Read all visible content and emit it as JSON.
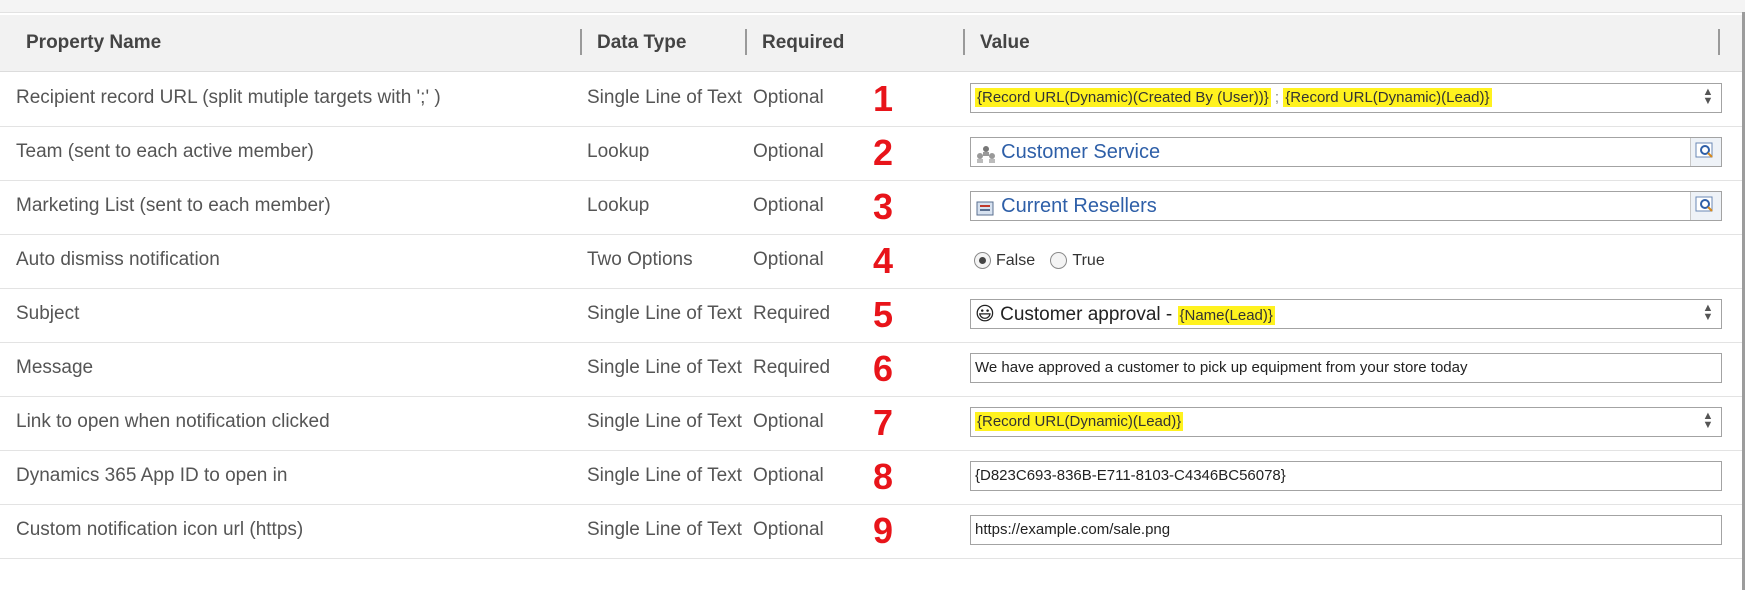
{
  "header": {
    "property_name": "Property Name",
    "data_type": "Data Type",
    "required": "Required",
    "value": "Value"
  },
  "rows": [
    {
      "name": "Recipient record URL (split mutiple targets with ';' )",
      "type": "Single Line of Text",
      "required": "Optional",
      "number": "1",
      "value_a": "{Record URL(Dynamic)(Created By (User))}",
      "separator": ";",
      "value_b": "{Record URL(Dynamic)(Lead)}"
    },
    {
      "name": "Team (sent to each active member)",
      "type": "Lookup",
      "required": "Optional",
      "number": "2",
      "value": "Customer Service",
      "icon": "team-icon"
    },
    {
      "name": "Marketing List (sent to each member)",
      "type": "Lookup",
      "required": "Optional",
      "number": "3",
      "value": "Current Resellers",
      "icon": "marketing-list-icon"
    },
    {
      "name": "Auto dismiss notification",
      "type": "Two Options",
      "required": "Optional",
      "number": "4",
      "option_false": "False",
      "option_true": "True",
      "selected": "False"
    },
    {
      "name": "Subject",
      "type": "Single Line of Text",
      "required": "Required",
      "number": "5",
      "emoji": "😃",
      "value_prefix": "Customer approval - ",
      "value_dynamic": "{Name(Lead)}"
    },
    {
      "name": "Message",
      "type": "Single Line of Text",
      "required": "Required",
      "number": "6",
      "value": "We have approved a customer to pick up equipment from your store today"
    },
    {
      "name": "Link to open when notification clicked",
      "type": "Single Line of Text",
      "required": "Optional",
      "number": "7",
      "value_dynamic": "{Record URL(Dynamic)(Lead)}"
    },
    {
      "name": "Dynamics 365 App ID to open in",
      "type": "Single Line of Text",
      "required": "Optional",
      "number": "8",
      "value": "{D823C693-836B-E711-8103-C4346BC56078}"
    },
    {
      "name": "Custom notification icon url (https)",
      "type": "Single Line of Text",
      "required": "Optional",
      "number": "9",
      "value": "https://example.com/sale.png"
    }
  ],
  "colors": {
    "highlight": "#fff21e",
    "number": "#e8141a",
    "link": "#2e5fa8",
    "header_bg": "#f2f2f2"
  },
  "icons": [
    "team-icon",
    "marketing-list-icon",
    "lookup-search-icon",
    "spinner-icon"
  ]
}
